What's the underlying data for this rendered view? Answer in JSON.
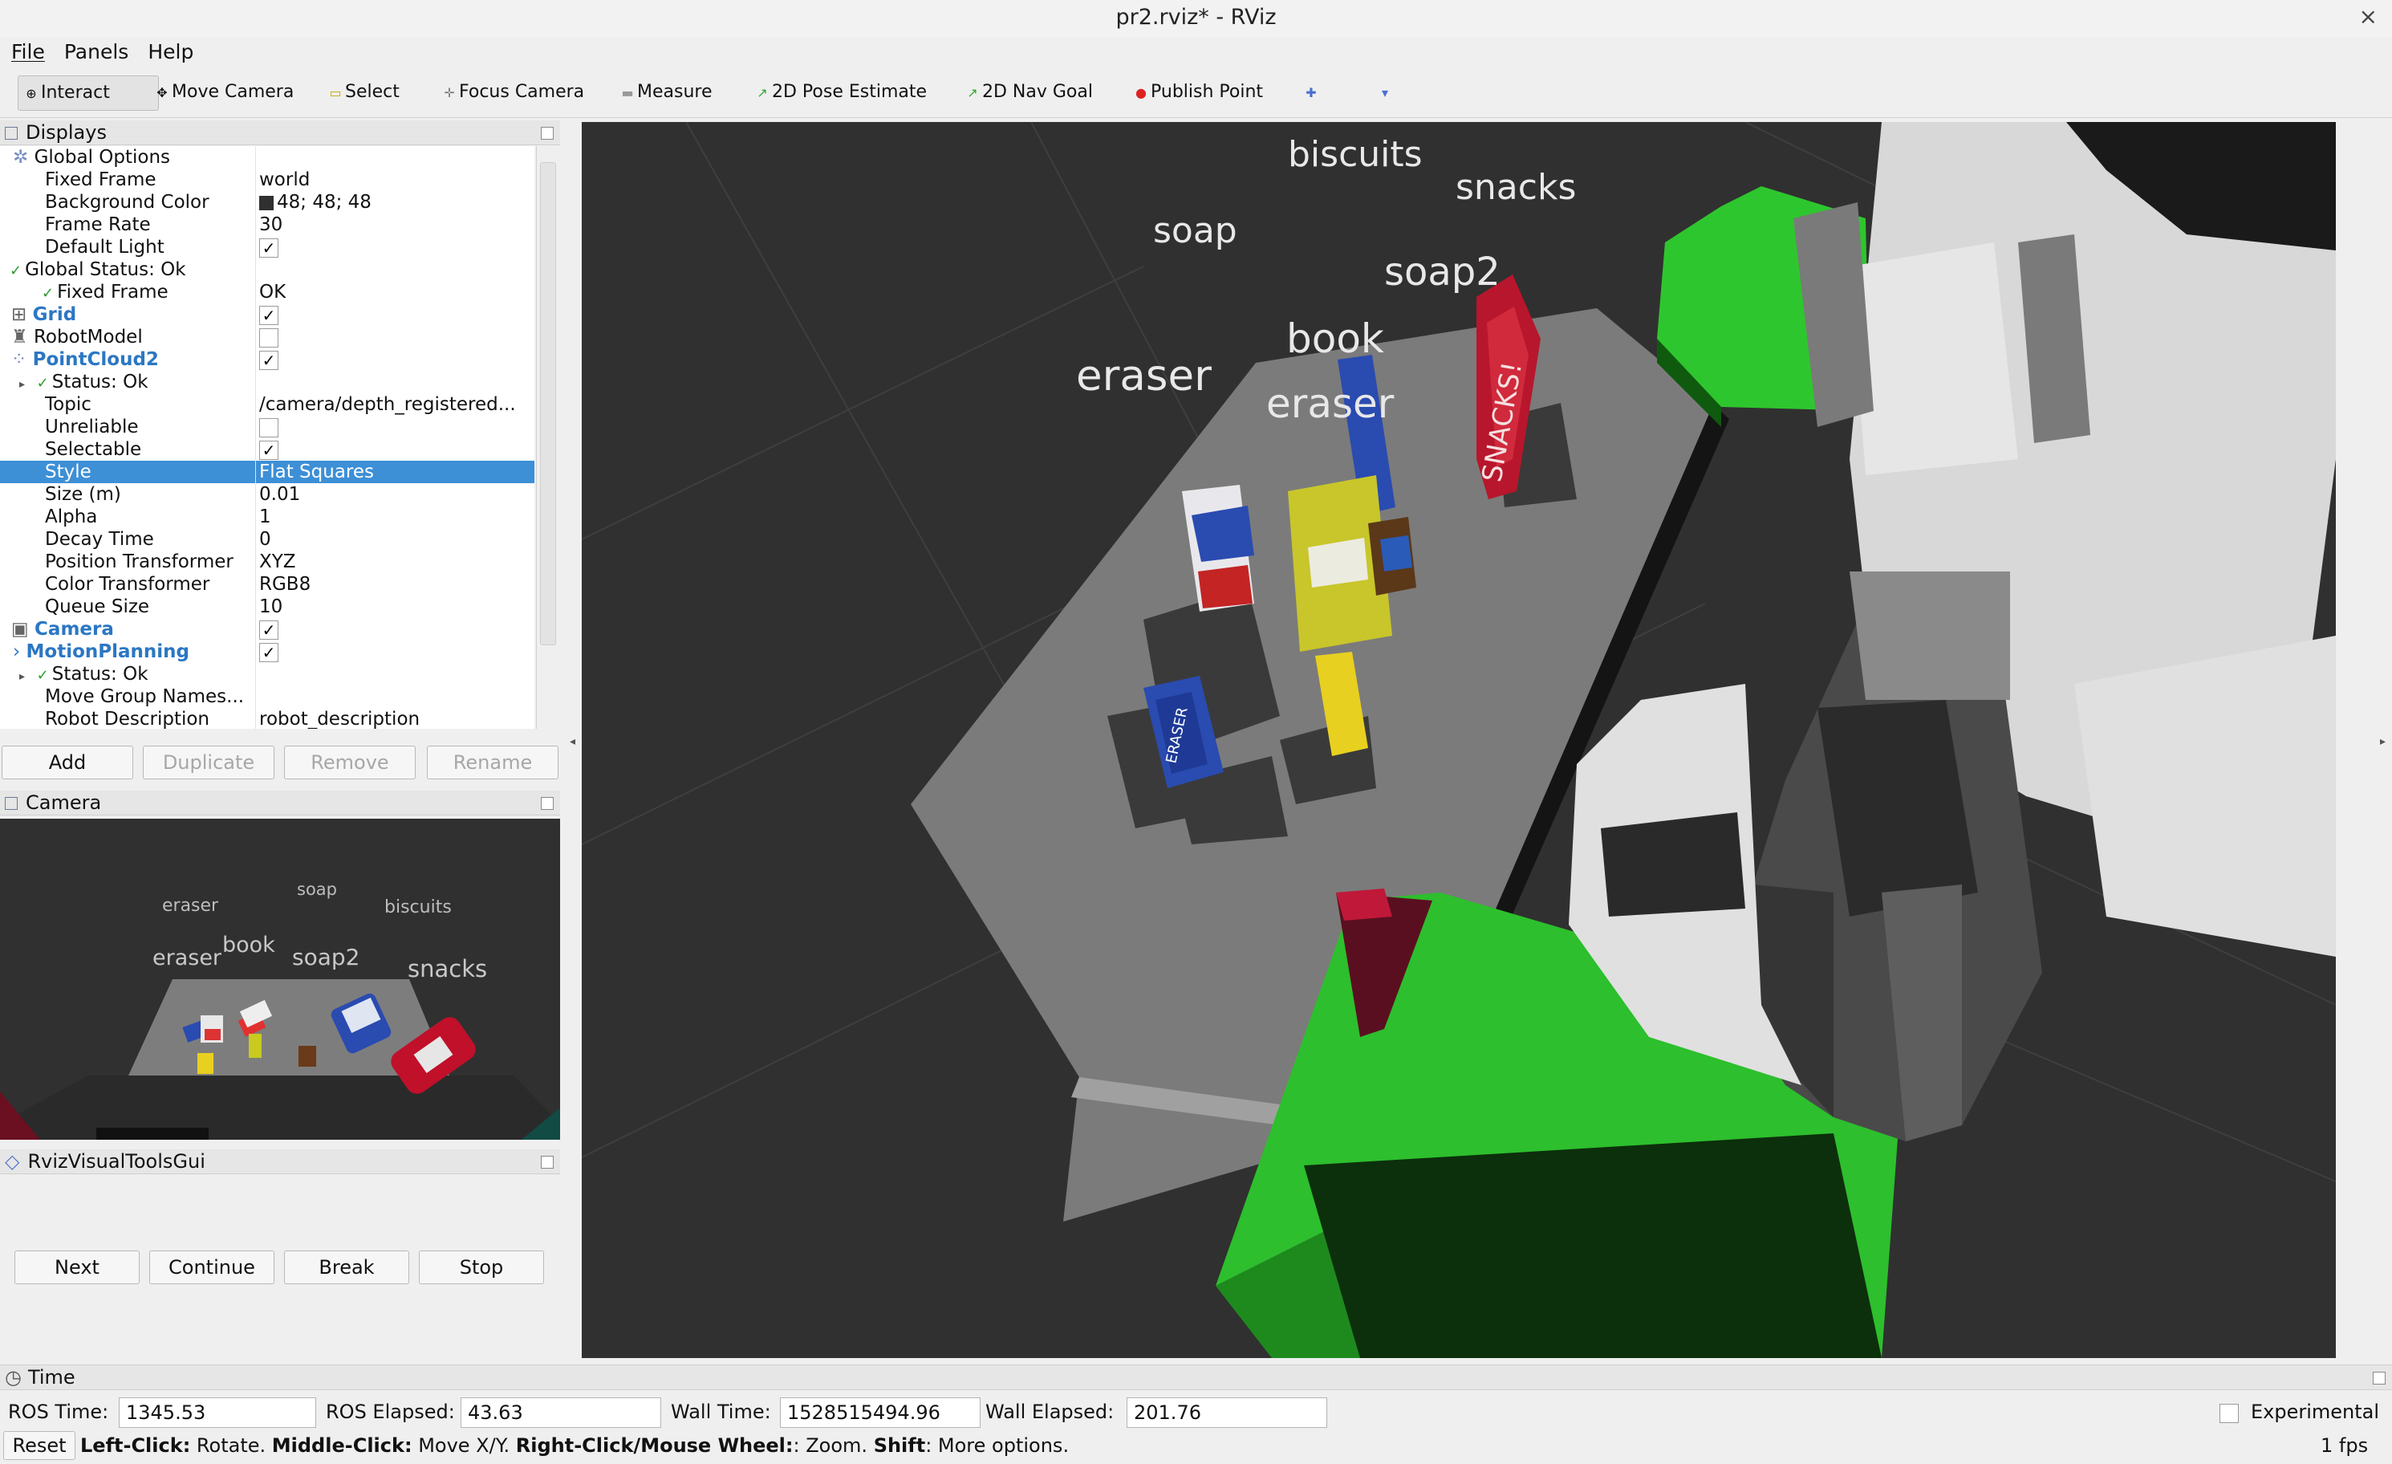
{
  "window": {
    "title": "pr2.rviz* - RViz",
    "close": "×"
  },
  "menu": [
    "File",
    "Panels",
    "Help"
  ],
  "toolbar": {
    "interact": "Interact",
    "move_camera": "Move Camera",
    "select": "Select",
    "focus_camera": "Focus Camera",
    "measure": "Measure",
    "pose_estimate": "2D Pose Estimate",
    "nav_goal": "2D Nav Goal",
    "publish_point": "Publish Point"
  },
  "displays": {
    "title": "Displays",
    "rows": [
      {
        "k": "Global Options",
        "v": ""
      },
      {
        "k": "Fixed Frame",
        "v": "world"
      },
      {
        "k": "Background Color",
        "v": "48; 48; 48"
      },
      {
        "k": "Frame Rate",
        "v": "30"
      },
      {
        "k": "Default Light",
        "v": "✓"
      },
      {
        "k": "Global Status: Ok",
        "v": ""
      },
      {
        "k": "Fixed Frame",
        "v": "OK"
      },
      {
        "k": "Grid",
        "v": "✓"
      },
      {
        "k": "RobotModel",
        "v": ""
      },
      {
        "k": "PointCloud2",
        "v": "✓"
      },
      {
        "k": "Status: Ok",
        "v": ""
      },
      {
        "k": "Topic",
        "v": "/camera/depth_registered..."
      },
      {
        "k": "Unreliable",
        "v": ""
      },
      {
        "k": "Selectable",
        "v": "✓"
      },
      {
        "k": "Style",
        "v": "Flat Squares"
      },
      {
        "k": "Size (m)",
        "v": "0.01"
      },
      {
        "k": "Alpha",
        "v": "1"
      },
      {
        "k": "Decay Time",
        "v": "0"
      },
      {
        "k": "Position Transformer",
        "v": "XYZ"
      },
      {
        "k": "Color Transformer",
        "v": "RGB8"
      },
      {
        "k": "Queue Size",
        "v": "10"
      },
      {
        "k": "Camera",
        "v": "✓"
      },
      {
        "k": "MotionPlanning",
        "v": "✓"
      },
      {
        "k": "Status: Ok",
        "v": ""
      },
      {
        "k": "Move Group Names...",
        "v": ""
      },
      {
        "k": "Robot Description",
        "v": "robot_description"
      }
    ],
    "buttons": {
      "add": "Add",
      "duplicate": "Duplicate",
      "remove": "Remove",
      "rename": "Rename"
    }
  },
  "camera_panel": {
    "title": "Camera",
    "labels": {
      "eraser_top": "eraser",
      "soap": "soap",
      "biscuits": "biscuits",
      "eraser": "eraser",
      "book": "book",
      "soap2": "soap2",
      "snacks": "snacks"
    }
  },
  "visual_tools": {
    "title": "RvizVisualToolsGui",
    "buttons": {
      "next": "Next",
      "continue": "Continue",
      "break": "Break",
      "stop": "Stop"
    }
  },
  "viewport": {
    "labels": {
      "biscuits": "biscuits",
      "snacks": "snacks",
      "soap": "soap",
      "soap2": "soap2",
      "book": "book",
      "eraser_left": "eraser",
      "eraser": "eraser"
    },
    "package_text": {
      "snacks": "SNACKS!",
      "eraser": "ERASER"
    }
  },
  "time": {
    "title": "Time",
    "ros_time_label": "ROS Time:",
    "ros_time": "1345.53",
    "ros_elapsed_label": "ROS Elapsed:",
    "ros_elapsed": "43.63",
    "wall_time_label": "Wall Time:",
    "wall_time": "1528515494.96",
    "wall_elapsed_label": "Wall Elapsed:",
    "wall_elapsed": "201.76",
    "experimental": "Experimental",
    "reset": "Reset",
    "hint": {
      "left_b": "Left-Click:",
      "left": " Rotate. ",
      "middle_b": "Middle-Click:",
      "middle": " Move X/Y. ",
      "right_b": "Right-Click/Mouse Wheel:",
      "right": ": Zoom. ",
      "shift_b": "Shift",
      "shift": ": More options."
    },
    "fps": "1 fps"
  }
}
